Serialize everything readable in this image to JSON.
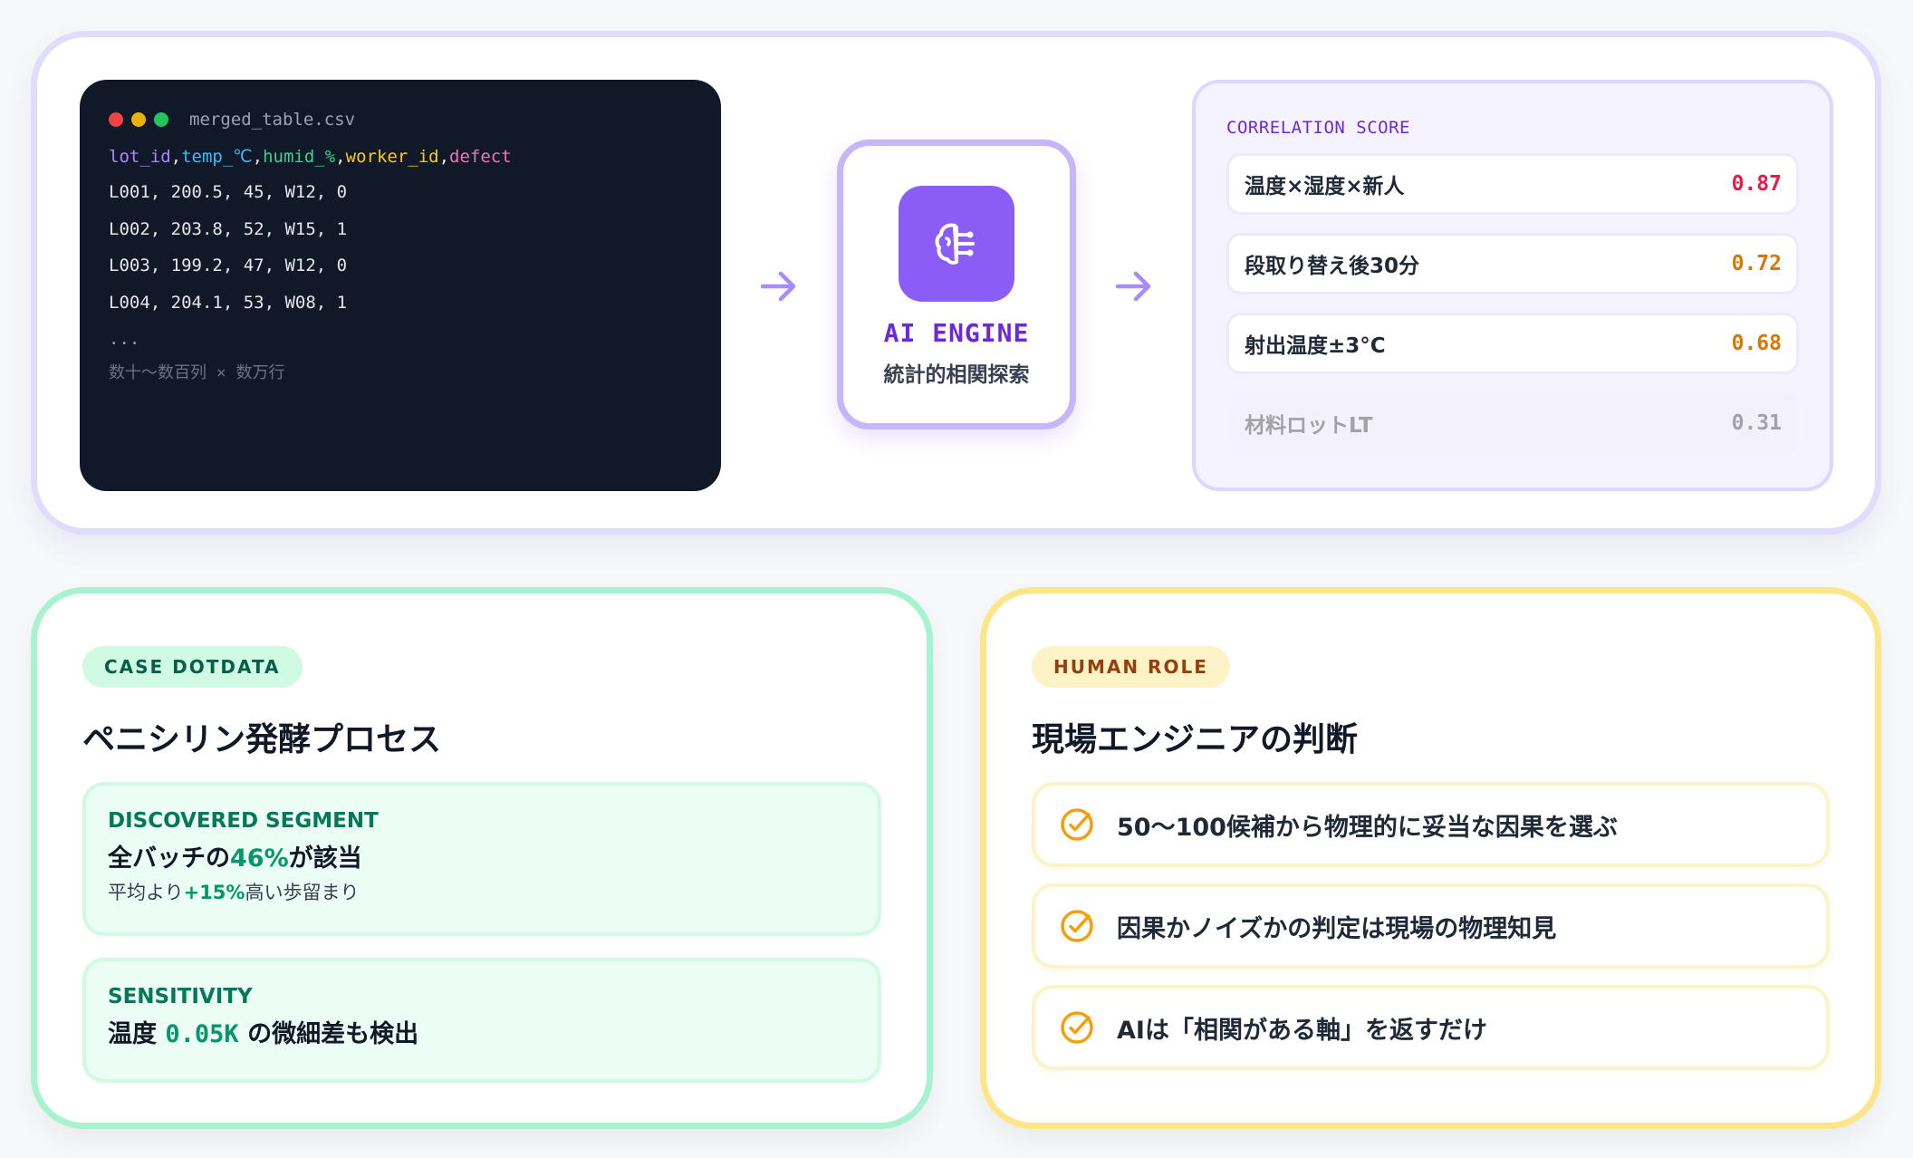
{
  "pipeline": {
    "code_window": {
      "filename": "merged_table.csv",
      "header_cols": [
        "lot_id",
        "temp_℃",
        "humid_%",
        "worker_id",
        "defect"
      ],
      "header_colors": [
        "#a78bfa",
        "#38bdf8",
        "#34d399",
        "#facc15",
        "#f472b6"
      ],
      "header_sep": ",",
      "rows": [
        "L001, 200.5, 45, W12, 0",
        "L002, 203.8, 52, W15, 1",
        "L003, 199.2, 47, W12, 0",
        "L004, 204.1, 53, W08, 1"
      ],
      "ellipsis": "...",
      "note": "数十〜数百列 × 数万行"
    },
    "engine": {
      "icon": "brain-circuit-icon",
      "title": "AI ENGINE",
      "subtitle": "統計的相関探索"
    },
    "score_panel": {
      "title": "CORRELATION SCORE",
      "items": [
        {
          "label": "温度×湿度×新人",
          "value": "0.87",
          "color": "#e11d48"
        },
        {
          "label": "段取り替え後30分",
          "value": "0.72",
          "color": "#d97706"
        },
        {
          "label": "射出温度±3°C",
          "value": "0.68",
          "color": "#d97706"
        },
        {
          "label": "材料ロットLT",
          "value": "0.31",
          "color": "#a1a1aa"
        }
      ]
    }
  },
  "case_card": {
    "tag": "CASE DOTDATA",
    "title": "ペニシリン発酵プロセス",
    "segment": {
      "label": "DISCOVERED SEGMENT",
      "main_prefix": "全バッチの",
      "main_em": "46%",
      "main_suffix": "が該当",
      "sub_prefix": "平均より",
      "sub_em": "+15%",
      "sub_suffix": "高い歩留まり"
    },
    "sensitivity": {
      "label": "SENSITIVITY",
      "main_prefix": "温度 ",
      "main_em": "0.05K",
      "main_suffix": " の微細差も検出"
    }
  },
  "role_card": {
    "tag": "HUMAN ROLE",
    "title": "現場エンジニアの判断",
    "items": [
      {
        "icon": "check-circle-icon",
        "text": "50〜100候補から物理的に妥当な因果を選ぶ"
      },
      {
        "icon": "check-circle-icon",
        "text": "因果かノイズかの判定は現場の物理知見"
      },
      {
        "icon": "check-circle-icon",
        "text": "AIは「相関がある軸」を返すだけ"
      }
    ]
  },
  "colors": {
    "accent_purple": "#8b5cf6",
    "green_border": "#a7f3d0",
    "yellow_border": "#fde68a",
    "check_color": "#f59e0b"
  }
}
